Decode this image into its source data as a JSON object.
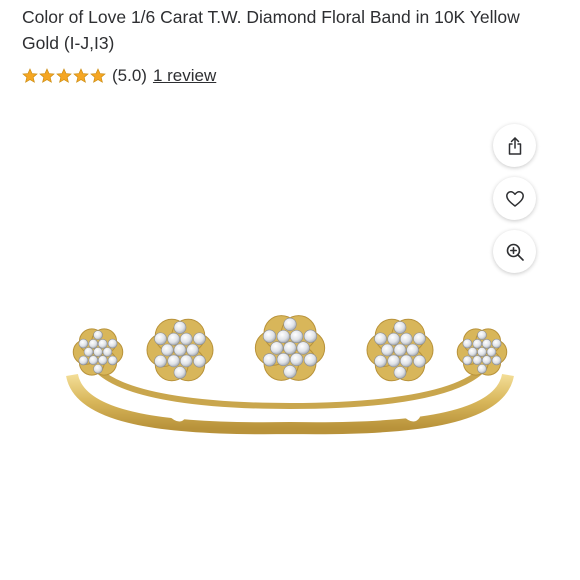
{
  "product": {
    "title": "Color of Love 1/6 Carat T.W. Diamond Floral Band in 10K Yellow Gold (I-J,I3)",
    "rating": {
      "stars": 5,
      "star_color": "#f5a623",
      "value_text": "(5.0)",
      "review_link": "1 review"
    }
  },
  "actions": {
    "share_icon": "share-icon",
    "favorite_icon": "heart-icon",
    "zoom_icon": "zoom-in-icon"
  },
  "image": {
    "subject": "ring",
    "metal_color": "#d8b65a",
    "diamond_color": "#e6e8ec"
  }
}
